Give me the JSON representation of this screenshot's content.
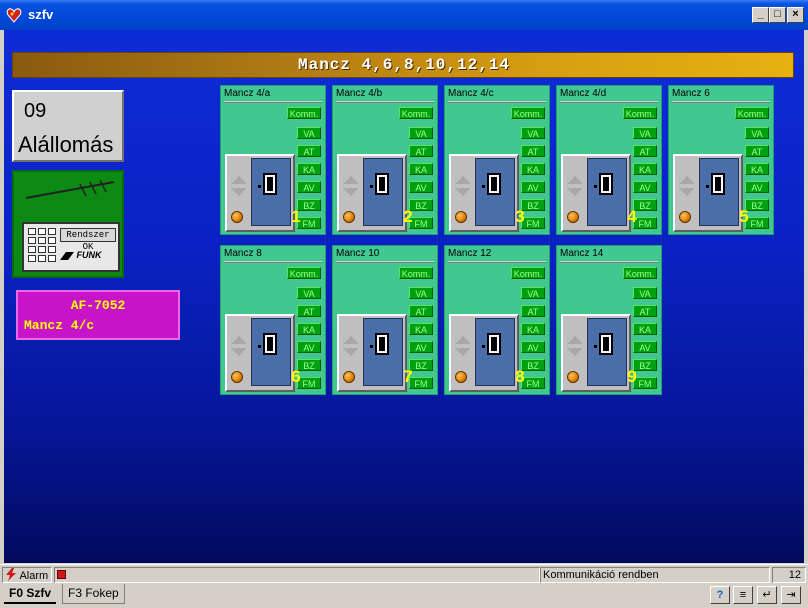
{
  "window": {
    "title": "szfv",
    "minimize_label": "_",
    "maximize_label": "□",
    "close_label": "×"
  },
  "banner": {
    "title": "Mancz 4,6,8,10,12,14"
  },
  "station": {
    "number": "09",
    "name": "Alállomás"
  },
  "device": {
    "lcd_text": "Rendszer OK",
    "brand": "FUNK",
    "icon": "radio-terminal-icon"
  },
  "alert": {
    "id": "AF-7052",
    "location": "Mancz 4/c",
    "color": "#c814c8"
  },
  "card_labels": {
    "komm": "Komm.",
    "va": "VA",
    "at": "AT",
    "ka": "KA",
    "av": "AV",
    "bz": "BZ",
    "fm": "FM"
  },
  "cards": [
    {
      "name": "Mancz 4/a",
      "number": "1"
    },
    {
      "name": "Mancz 4/b",
      "number": "2"
    },
    {
      "name": "Mancz 4/c",
      "number": "3"
    },
    {
      "name": "Mancz 4/d",
      "number": "4"
    },
    {
      "name": "Mancz 6",
      "number": "5"
    },
    {
      "name": "Mancz 8",
      "number": "6"
    },
    {
      "name": "Mancz 10",
      "number": "7"
    },
    {
      "name": "Mancz 12",
      "number": "8"
    },
    {
      "name": "Mancz 14",
      "number": "9"
    }
  ],
  "statusbar": {
    "alarm_label": "Alarm",
    "message": "Kommunikáció rendben",
    "count": "12"
  },
  "tabs": [
    {
      "label": "F0 Szfv",
      "active": true
    },
    {
      "label": "F3 Fokep",
      "active": false
    }
  ],
  "toolbar": {
    "help_label": "?",
    "list_label": "≡",
    "enter_label": "↵",
    "exit_label": "⇥"
  },
  "colors": {
    "card_bg": "#40c890",
    "tag_bg": "#00a010",
    "banner": "#d8a010",
    "background": "#0a22c4"
  }
}
